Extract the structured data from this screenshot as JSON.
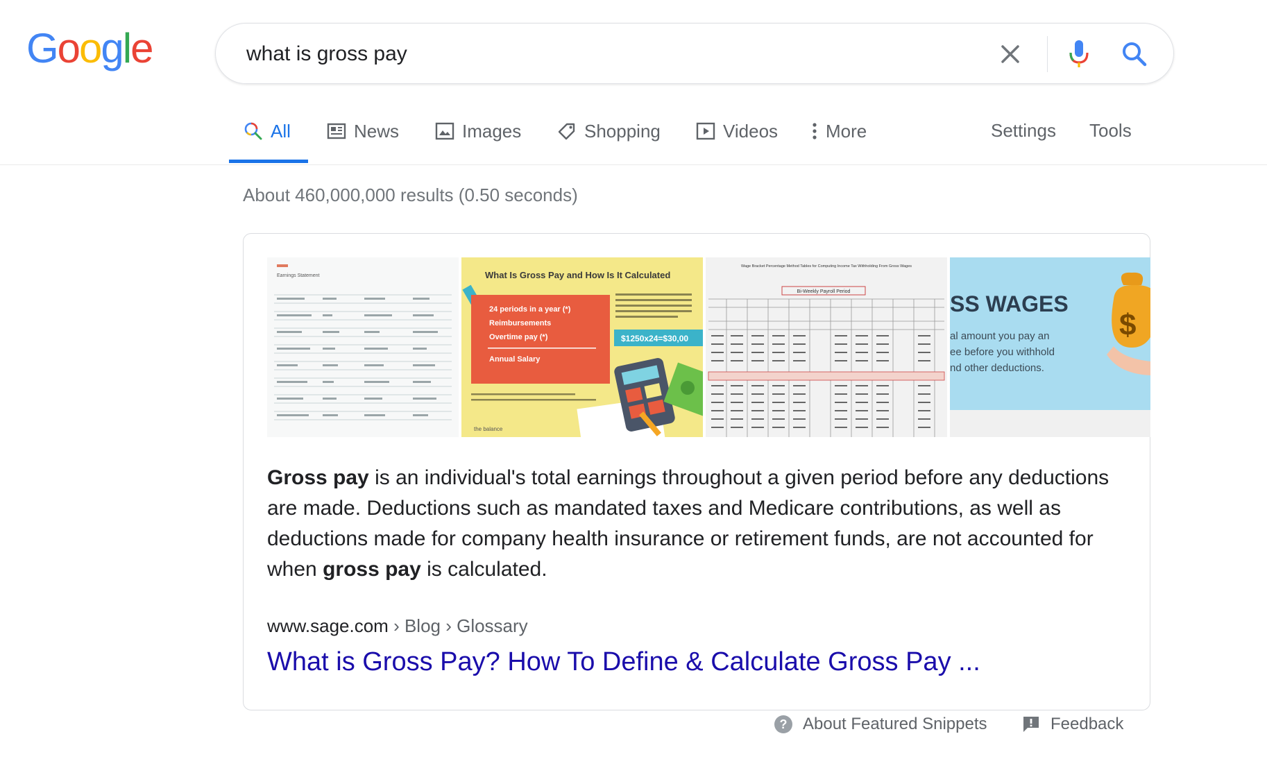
{
  "logo": {
    "letters": [
      "G",
      "o",
      "o",
      "g",
      "l",
      "e"
    ]
  },
  "search": {
    "query": "what is gross pay"
  },
  "tabs": [
    {
      "label": "All",
      "icon": "search-icon",
      "active": true
    },
    {
      "label": "News",
      "icon": "news-icon"
    },
    {
      "label": "Images",
      "icon": "image-icon"
    },
    {
      "label": "Shopping",
      "icon": "tag-icon"
    },
    {
      "label": "Videos",
      "icon": "play-icon"
    },
    {
      "label": "More",
      "icon": "more-vertical-icon"
    }
  ],
  "tools": {
    "settings": "Settings",
    "tools": "Tools"
  },
  "result_stats": "About 460,000,000 results (0.50 seconds)",
  "snippet": {
    "images": [
      {
        "label": "Earnings Statement",
        "icon": "earnings-statement-image"
      },
      {
        "title": "What Is Gross Pay and How Is It Calculated",
        "lines": [
          "24 periods in a year (*)",
          "Reimbursements",
          "Overtime pay (*)",
          "Annual Salary"
        ],
        "formula": "$1250x24=$30,00",
        "brand": "the balance"
      },
      {
        "title": "Wage Bracket Percentage Method Tables for Computing Income Tax Withholding From Gross Wages",
        "subtitle": "Bi-Weekly Payroll Period"
      },
      {
        "heading": "SS WAGES",
        "lines": [
          "al amount you pay an",
          "ee before you withhold",
          "nd other deductions."
        ]
      }
    ],
    "text": {
      "part1_bold": "Gross pay",
      "part2": " is an individual's total earnings throughout a given period before any deductions are made. Deductions such as mandated taxes and Medicare contributions, as well as deductions made for company health insurance or retirement funds, are not accounted for when ",
      "part3_bold": "gross pay",
      "part4": " is calculated."
    },
    "cite": {
      "host": "www.sage.com",
      "path": " › Blog › Glossary"
    },
    "title": "What is Gross Pay? How To Define & Calculate Gross Pay ..."
  },
  "footer": {
    "about": "About Featured Snippets",
    "feedback": "Feedback"
  },
  "colors": {
    "link": "#1a0dab",
    "accent": "#1a73e8",
    "muted": "#5f6368"
  }
}
